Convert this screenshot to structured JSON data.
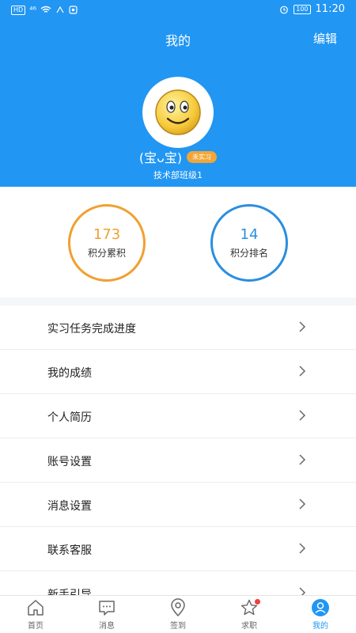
{
  "status_bar": {
    "hd": "HD",
    "signal": "⁴⁶",
    "battery": "100",
    "time": "11:20"
  },
  "header": {
    "title": "我的",
    "edit_label": "编辑"
  },
  "profile": {
    "name": "(宝ᴗ宝)",
    "status_badge": "未实习",
    "department": "技术部班级1"
  },
  "stats": [
    {
      "value": "173",
      "label": "积分累积",
      "color": "#f0a030"
    },
    {
      "value": "14",
      "label": "积分排名",
      "color": "#2a8ee0"
    }
  ],
  "menu": [
    {
      "label": "实习任务完成进度"
    },
    {
      "label": "我的成绩"
    },
    {
      "label": "个人简历"
    },
    {
      "label": "账号设置"
    },
    {
      "label": "消息设置"
    },
    {
      "label": "联系客服"
    },
    {
      "label": "新手引导"
    }
  ],
  "tabs": [
    {
      "label": "首页",
      "icon": "home-icon"
    },
    {
      "label": "消息",
      "icon": "message-icon"
    },
    {
      "label": "签到",
      "icon": "location-pin-icon"
    },
    {
      "label": "求职",
      "icon": "star-icon"
    },
    {
      "label": "我的",
      "icon": "user-icon",
      "active": true
    }
  ],
  "colors": {
    "primary": "#2196f3",
    "accent_orange": "#f0a030",
    "badge": "#f3a637"
  }
}
